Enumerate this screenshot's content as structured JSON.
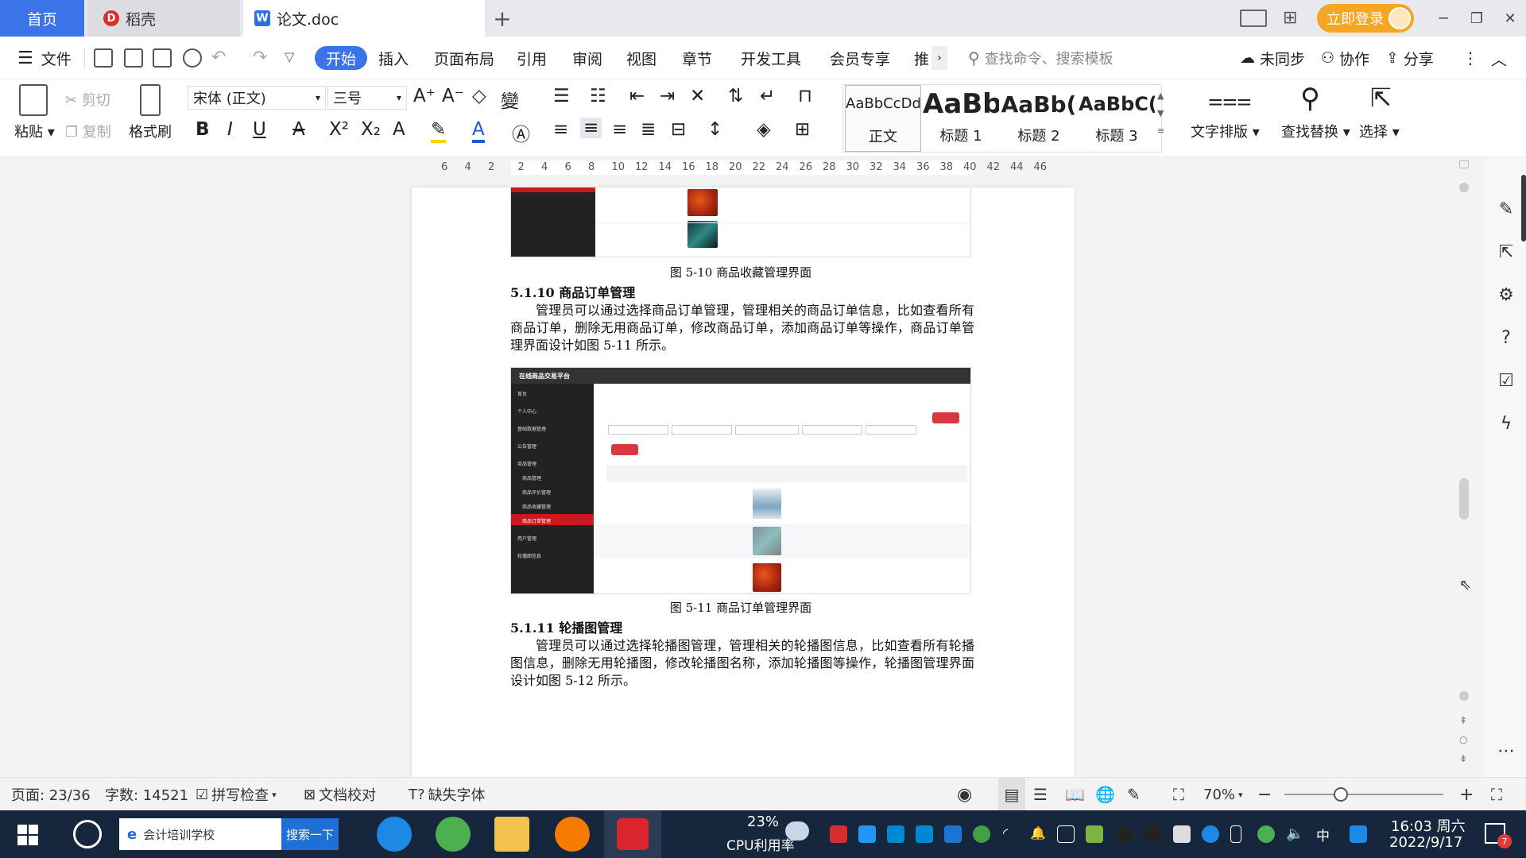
{
  "tabs": {
    "home": "首页",
    "daoke": "稻壳",
    "doc": "论文.doc",
    "add": "+",
    "login": "立即登录"
  },
  "menu": {
    "file": "文件",
    "items": [
      "开始",
      "插入",
      "页面布局",
      "引用",
      "审阅",
      "视图",
      "章节",
      "开发工具",
      "会员专享",
      "推"
    ],
    "search_placeholder": "查找命令、搜索模板",
    "sync": "未同步",
    "collab": "协作",
    "share": "分享"
  },
  "ribbon": {
    "paste": "粘贴",
    "cut": "剪切",
    "copy": "复制",
    "format_painter": "格式刷",
    "font_name": "宋体 (正文)",
    "font_size": "三号",
    "styles": [
      {
        "preview": "AaBbCcDd",
        "name": "正文"
      },
      {
        "preview": "AaBb",
        "name": "标题 1"
      },
      {
        "preview": "AaBb(",
        "name": "标题 2"
      },
      {
        "preview": "AaBbC(",
        "name": "标题 3"
      }
    ],
    "text_layout": "文字排版",
    "find_replace": "查找替换",
    "select": "选择"
  },
  "ruler": {
    "ticks": [
      "6",
      "4",
      "2",
      "2",
      "4",
      "6",
      "8",
      "10",
      "12",
      "14",
      "16",
      "18",
      "20",
      "22",
      "24",
      "26",
      "28",
      "30",
      "32",
      "34",
      "36",
      "38",
      "40",
      "42",
      "44",
      "46"
    ]
  },
  "document": {
    "caption_510": "图 5-10 商品收藏管理界面",
    "heading_5110": "5.1.10 商品订单管理",
    "para_5110": "管理员可以通过选择商品订单管理，管理相关的商品订单信息，比如查看所有商品订单，删除无用商品订单，修改商品订单，添加商品订单等操作，商品订单管理界面设计如图 5-11 所示。",
    "shot_title": "在线商品交易平台",
    "shot_side_items": [
      "首页",
      "个人中心",
      "基础数据管理",
      "公告管理",
      "商品管理",
      "商品管理",
      "商品评价管理",
      "商品收藏管理",
      "商品订单管理",
      "用户管理",
      "轮播图信息"
    ],
    "caption_511": "图 5-11 商品订单管理界面",
    "heading_5111": "5.1.11 轮播图管理",
    "para_5111": "管理员可以通过选择轮播图管理，管理相关的轮播图信息，比如查看所有轮播图信息，删除无用轮播图，修改轮播图名称，添加轮播图等操作，轮播图管理界面设计如图 5-12 所示。"
  },
  "status": {
    "page": "页面: 23/36",
    "words": "字数: 14521",
    "spell": "拼写检查",
    "proof": "文档校对",
    "missing_font": "缺失字体",
    "zoom": "70%"
  },
  "taskbar": {
    "search_text": "会计培训学校",
    "search_btn": "搜索一下",
    "cpu_pct": "23%",
    "cpu_label": "CPU利用率",
    "ime": "中",
    "time": "16:03 周六",
    "date": "2022/9/17",
    "notif": "7"
  }
}
